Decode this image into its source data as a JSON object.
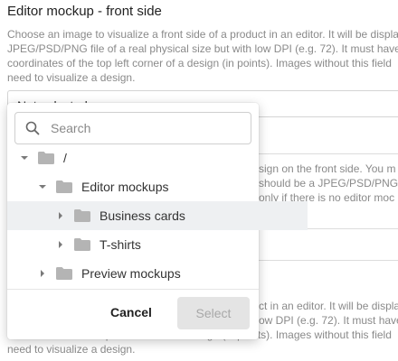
{
  "background": {
    "section_title": "Editor mockup - front side",
    "description_lines": [
      "Choose an image to visualize a front side of a product in an editor. It will be displa",
      "JPEG/PSD/PNG file of a real physical size but with low DPI (e.g. 72). It must have",
      "coordinates of the top left corner of a design (in points). Images without this field",
      "need to visualize a design."
    ],
    "select_value": "Not selected",
    "second_desc_lines": [
      "sign on the front side. You m",
      "should be a JPEG/PSD/PNG/S",
      "only if there is no editor moc"
    ],
    "third_desc_lines": [
      "ct in an editor. It will be displa",
      "ow DPI (e.g. 72). It must have",
      "coordinates of the top left corner of a design (in points). Images without this field",
      "need to visualize a design."
    ]
  },
  "dropdown": {
    "search": {
      "placeholder": "Search",
      "value": ""
    },
    "tree": [
      {
        "label": "/",
        "expanded": true
      },
      {
        "label": "Editor mockups",
        "expanded": true
      },
      {
        "label": "Business cards",
        "expanded": false,
        "highlighted": true
      },
      {
        "label": "T-shirts",
        "expanded": false
      },
      {
        "label": "Preview mockups",
        "expanded": false
      }
    ],
    "cancel_label": "Cancel",
    "select_label": "Select"
  },
  "colors": {
    "folder_icon": "#b4b4b4",
    "highlight_row": "#eef0f2",
    "disabled_button_bg": "#e4e4e4",
    "disabled_button_text": "#a8a8a8",
    "description_text": "#8a8a8a"
  }
}
